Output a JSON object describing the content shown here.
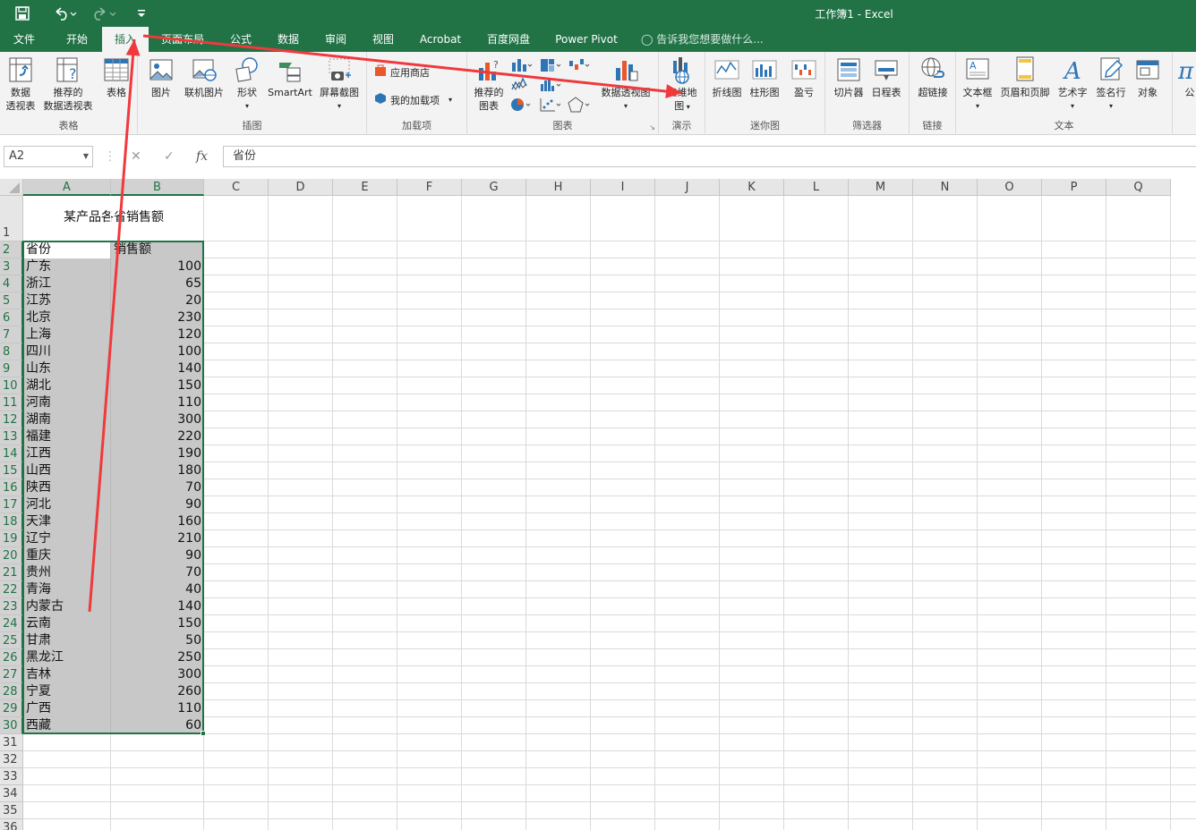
{
  "window": {
    "title": "工作簿1 - Excel"
  },
  "quick_access": {
    "save_icon": "save-icon",
    "undo_icon": "undo-icon",
    "redo_icon": "redo-icon",
    "customize_icon": "customize-qat-icon"
  },
  "tabs": [
    {
      "label": "文件"
    },
    {
      "label": "开始"
    },
    {
      "label": "插入"
    },
    {
      "label": "页面布局"
    },
    {
      "label": "公式"
    },
    {
      "label": "数据"
    },
    {
      "label": "审阅"
    },
    {
      "label": "视图"
    },
    {
      "label": "Acrobat"
    },
    {
      "label": "百度网盘"
    },
    {
      "label": "Power Pivot"
    }
  ],
  "tell_me": "告诉我您想要做什么...",
  "ribbon": {
    "groups": {
      "tables": "表格",
      "illustrations": "插图",
      "addins": "加载项",
      "charts": "图表",
      "tours": "演示",
      "sparklines": "迷你图",
      "filters": "筛选器",
      "links": "链接",
      "text": "文本"
    },
    "buttons": {
      "pivot_l1": "数据",
      "pivot_l2": "透视表",
      "rec_pivot_l1": "推荐的",
      "rec_pivot_l2": "数据透视表",
      "table": "表格",
      "picture": "图片",
      "online_picture": "联机图片",
      "shapes": "形状",
      "smartart": "SmartArt",
      "screenshot": "屏幕截图",
      "store": "应用商店",
      "my_addins": "我的加载项",
      "rec_charts_l1": "推荐的",
      "rec_charts_l2": "图表",
      "pivot_chart": "数据透视图",
      "map3d_l1": "三维地",
      "map3d_l2": "图",
      "line": "折线图",
      "column": "柱形图",
      "winloss": "盈亏",
      "slicer": "切片器",
      "timeline": "日程表",
      "hyperlink": "超链接",
      "textbox": "文本框",
      "header_footer": "页眉和页脚",
      "wordart": "艺术字",
      "signature": "签名行",
      "object": "对象",
      "equation": "公"
    }
  },
  "formula_bar": {
    "name_box": "A2",
    "fx": "fx",
    "content": "省份"
  },
  "columns": [
    "A",
    "B",
    "C",
    "D",
    "E",
    "F",
    "G",
    "H",
    "I",
    "J",
    "K",
    "L",
    "M",
    "N",
    "O",
    "P",
    "Q"
  ],
  "rows": [
    "1",
    "2",
    "3",
    "4",
    "5",
    "6",
    "7",
    "8",
    "9",
    "10",
    "11",
    "12",
    "13",
    "14",
    "15",
    "16",
    "17",
    "18",
    "19",
    "20",
    "21",
    "22",
    "23",
    "24",
    "25",
    "26",
    "27",
    "28",
    "29",
    "30",
    "31",
    "32",
    "33",
    "34",
    "35",
    "36"
  ],
  "sheet": {
    "title": "某产品各省销售额",
    "header": [
      "省份",
      "销售额"
    ],
    "data": [
      [
        "广东",
        "100"
      ],
      [
        "浙江",
        "65"
      ],
      [
        "江苏",
        "20"
      ],
      [
        "北京",
        "230"
      ],
      [
        "上海",
        "120"
      ],
      [
        "四川",
        "100"
      ],
      [
        "山东",
        "140"
      ],
      [
        "湖北",
        "150"
      ],
      [
        "河南",
        "110"
      ],
      [
        "湖南",
        "300"
      ],
      [
        "福建",
        "220"
      ],
      [
        "江西",
        "190"
      ],
      [
        "山西",
        "180"
      ],
      [
        "陕西",
        "70"
      ],
      [
        "河北",
        "90"
      ],
      [
        "天津",
        "160"
      ],
      [
        "辽宁",
        "210"
      ],
      [
        "重庆",
        "90"
      ],
      [
        "贵州",
        "70"
      ],
      [
        "青海",
        "40"
      ],
      [
        "内蒙古",
        "140"
      ],
      [
        "云南",
        "150"
      ],
      [
        "甘肃",
        "50"
      ],
      [
        "黑龙江",
        "250"
      ],
      [
        "吉林",
        "300"
      ],
      [
        "宁夏",
        "260"
      ],
      [
        "广西",
        "110"
      ],
      [
        "西藏",
        "60"
      ]
    ]
  },
  "colors": {
    "accent": "#217346",
    "arrow": "#f0393c"
  }
}
